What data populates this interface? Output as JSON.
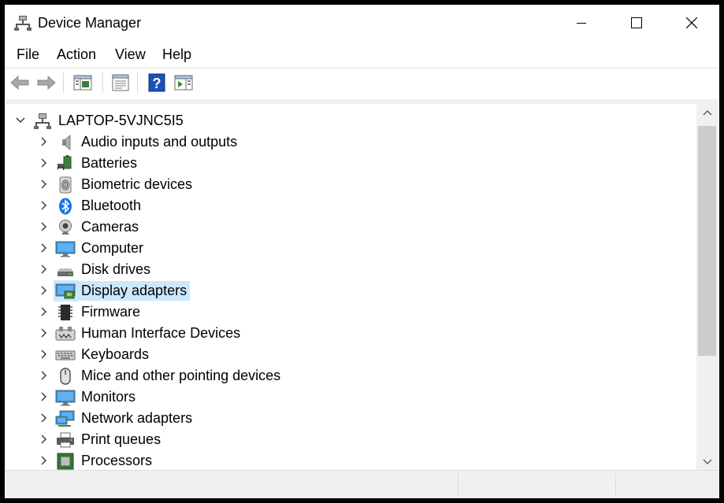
{
  "window": {
    "title": "Device Manager",
    "app_icon": "device-manager-icon"
  },
  "menu": [
    {
      "label": "File"
    },
    {
      "label": "Action"
    },
    {
      "label": "View"
    },
    {
      "label": "Help"
    }
  ],
  "toolbar": [
    {
      "name": "back-button",
      "icon": "arrow-left-icon"
    },
    {
      "name": "forward-button",
      "icon": "arrow-right-icon"
    },
    {
      "name": "show-hide-console-tree-button",
      "icon": "console-tree-icon"
    },
    {
      "name": "properties-button",
      "icon": "properties-icon"
    },
    {
      "name": "help-button",
      "icon": "help-icon"
    },
    {
      "name": "show-hide-action-pane-button",
      "icon": "action-pane-icon"
    }
  ],
  "tree": {
    "root": {
      "label": "LAPTOP-5VJNC5I5",
      "icon": "computer-network-icon",
      "expanded": true
    },
    "items": [
      {
        "label": "Audio inputs and outputs",
        "icon": "speaker-icon"
      },
      {
        "label": "Batteries",
        "icon": "battery-icon"
      },
      {
        "label": "Biometric devices",
        "icon": "fingerprint-icon"
      },
      {
        "label": "Bluetooth",
        "icon": "bluetooth-icon"
      },
      {
        "label": "Cameras",
        "icon": "webcam-icon"
      },
      {
        "label": "Computer",
        "icon": "monitor-icon"
      },
      {
        "label": "Disk drives",
        "icon": "disk-drive-icon"
      },
      {
        "label": "Display adapters",
        "icon": "display-adapter-icon",
        "selected": true
      },
      {
        "label": "Firmware",
        "icon": "chip-icon"
      },
      {
        "label": "Human Interface Devices",
        "icon": "hid-icon"
      },
      {
        "label": "Keyboards",
        "icon": "keyboard-icon"
      },
      {
        "label": "Mice and other pointing devices",
        "icon": "mouse-icon"
      },
      {
        "label": "Monitors",
        "icon": "monitor-icon"
      },
      {
        "label": "Network adapters",
        "icon": "network-adapter-icon"
      },
      {
        "label": "Print queues",
        "icon": "printer-icon"
      },
      {
        "label": "Processors",
        "icon": "processor-icon"
      }
    ]
  },
  "colors": {
    "selection": "#cce8ff",
    "accent": "#0078d7"
  }
}
